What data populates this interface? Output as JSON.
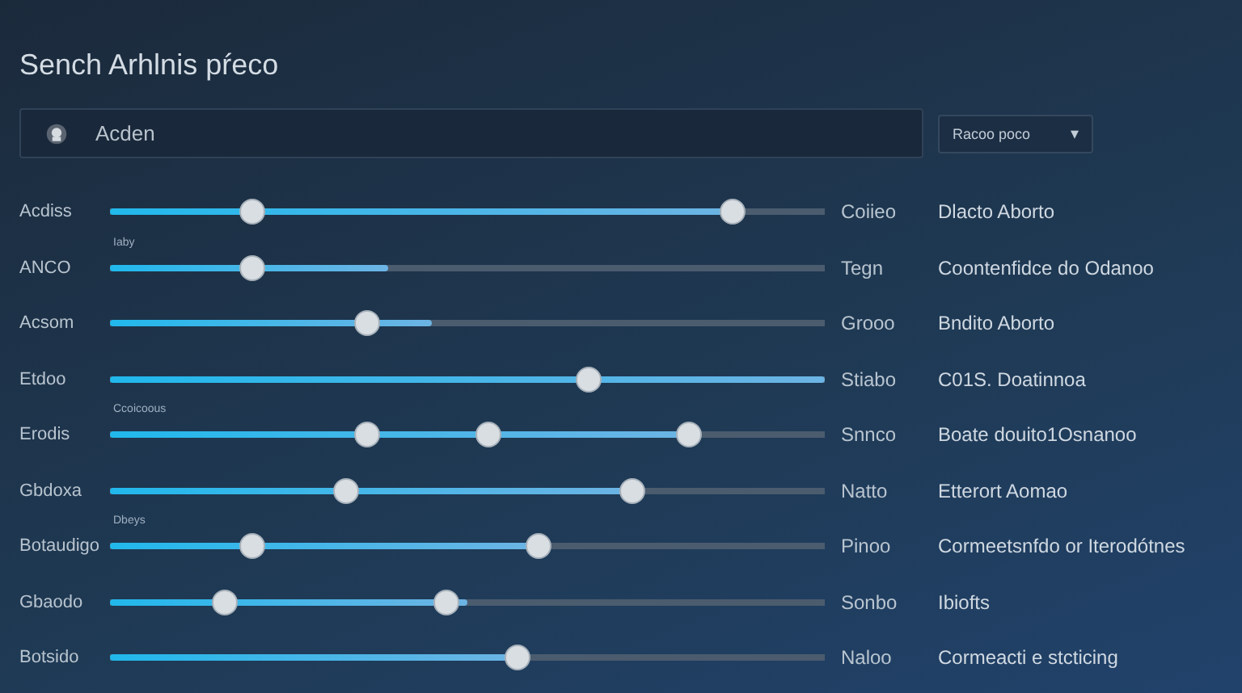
{
  "title": "Sench Arhlnis pŕeco",
  "search": {
    "value": "Acden"
  },
  "dropdown": {
    "value": "Racoo poco",
    "caret": "▾"
  },
  "rows": [
    {
      "label": "Acdiss",
      "level": 0.87,
      "handles": [
        {
          "level": 0.2
        },
        {
          "level": 0.87
        }
      ],
      "value": "Coiieo",
      "description": "Dlacto Aborto"
    },
    {
      "label": "ANCO",
      "note": "Iaby",
      "level": 0.39,
      "handles": [
        {
          "level": 0.2
        }
      ],
      "value": "Tegn",
      "description": "Coontenfidce do Odanoo"
    },
    {
      "label": "Acsom",
      "level": 0.45,
      "handles": [
        {
          "level": 0.36
        }
      ],
      "value": "Grooo",
      "description": "Bndito Aborto"
    },
    {
      "label": "Etdoo",
      "level": 1,
      "handles": [
        {
          "level": 0.67
        }
      ],
      "value": "Stiabo",
      "description": "C01S. Doatinnoa"
    },
    {
      "label": "Erodis",
      "note": "Ccoicoous",
      "level": 0.81,
      "handles": [
        {
          "level": 0.36
        },
        {
          "level": 0.53
        },
        {
          "level": 0.81
        }
      ],
      "value": "Snnco",
      "description": "Boate douito1Osnanoo"
    },
    {
      "label": "Gbdoxa",
      "level": 0.73,
      "handles": [
        {
          "level": 0.33
        },
        {
          "level": 0.73
        }
      ],
      "value": "Natto",
      "description": "Etterort Aomao"
    },
    {
      "label": "Botaudigo",
      "note": "Dbeys",
      "level": 0.6,
      "handles": [
        {
          "level": 0.2
        },
        {
          "level": 0.6
        }
      ],
      "value": "Pinoo",
      "description": "Cormeetsnfdo or Iterodótnes"
    },
    {
      "label": "Gbaodo",
      "level": 0.5,
      "handles": [
        {
          "level": 0.16
        },
        {
          "level": 0.47
        }
      ],
      "value": "Sonbo",
      "description": "Ibiofts"
    },
    {
      "label": "Botsido",
      "level": 0.57,
      "handles": [
        {
          "level": 0.57
        }
      ],
      "value": "Naloo",
      "description": "Cormeacti e stcticing"
    }
  ]
}
